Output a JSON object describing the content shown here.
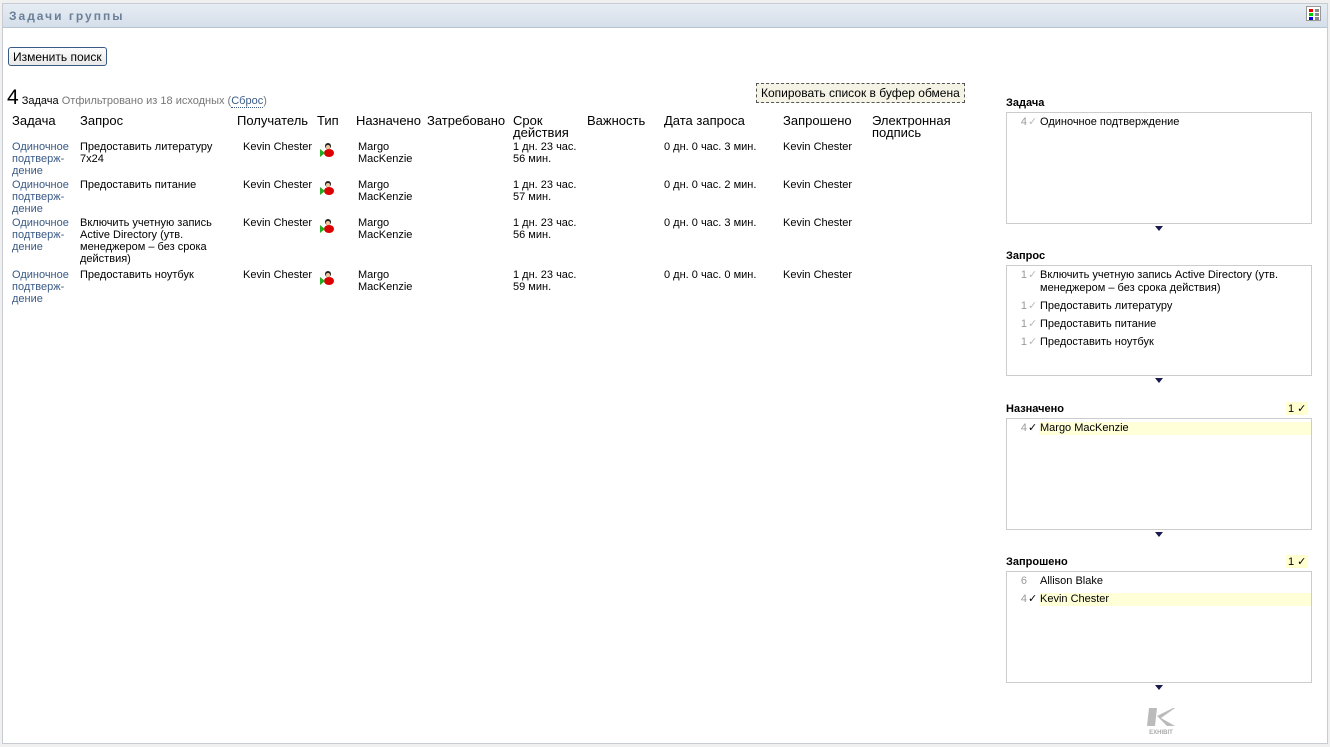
{
  "header": {
    "title": "Задачи группы",
    "icon": "view-options-icon"
  },
  "toolbar": {
    "edit_search": "Изменить поиск",
    "copy_label": "Копировать список в буфер обмена"
  },
  "summary": {
    "count": "4",
    "unit": "Задача",
    "filtered": "Отфильтровано из 18 исходных (",
    "reset": "Сброс",
    "close": ")"
  },
  "columns": [
    "Задача",
    "Запрос",
    "Получатель",
    "Тип",
    "Назначено",
    "Затребовано",
    "Срок действия",
    "Важность",
    "Дата запроса",
    "Запрошено",
    "Электронная подпись"
  ],
  "rows": [
    {
      "task": "Одиночное подтверж-дение",
      "request": "Предоставить литературу 7x24",
      "recipient": "Kevin Chester",
      "type": "approval-user-icon",
      "assigned": "Margo MacKenzie",
      "claimed": "",
      "expires": "1 дн. 23 час. 56 мин.",
      "priority": "",
      "requested_date": "0 дн. 0 час. 3 мин.",
      "requested_by": "Kevin Chester",
      "signature": ""
    },
    {
      "task": "Одиночное подтверж-дение",
      "request": "Предоставить питание",
      "recipient": "Kevin Chester",
      "type": "approval-user-icon",
      "assigned": "Margo MacKenzie",
      "claimed": "",
      "expires": "1 дн. 23 час. 57 мин.",
      "priority": "",
      "requested_date": "0 дн. 0 час. 2 мин.",
      "requested_by": "Kevin Chester",
      "signature": ""
    },
    {
      "task": "Одиночное подтверж-дение",
      "request": "Включить учетную запись Active Directory (утв. менеджером – без срока действия)",
      "recipient": "Kevin Chester",
      "type": "approval-user-icon",
      "assigned": "Margo MacKenzie",
      "claimed": "",
      "expires": "1 дн. 23 час. 56 мин.",
      "priority": "",
      "requested_date": "0 дн. 0 час. 3 мин.",
      "requested_by": "Kevin Chester",
      "signature": ""
    },
    {
      "task": "Одиночное подтверж-дение",
      "request": "Предоставить ноутбук",
      "recipient": "Kevin Chester",
      "type": "approval-user-icon",
      "assigned": "Margo MacKenzie",
      "claimed": "",
      "expires": "1 дн. 23 час. 59 мин.",
      "priority": "",
      "requested_date": "0 дн. 0 час. 0 мин.",
      "requested_by": "Kevin Chester",
      "signature": ""
    }
  ],
  "facets": [
    {
      "title": "Задача",
      "badge": "",
      "items": [
        {
          "count": "4",
          "label": "Одиночное подтверждение",
          "selected": false
        }
      ]
    },
    {
      "title": "Запрос",
      "badge": "",
      "items": [
        {
          "count": "1",
          "label": "Включить учетную запись Active Directory (утв. менеджером – без срока действия)",
          "selected": false
        },
        {
          "count": "1",
          "label": "Предоставить литературу",
          "selected": false
        },
        {
          "count": "1",
          "label": "Предоставить питание",
          "selected": false
        },
        {
          "count": "1",
          "label": "Предоставить ноутбук",
          "selected": false
        }
      ]
    },
    {
      "title": "Назначено",
      "badge": "1 ✓",
      "items": [
        {
          "count": "4",
          "label": "Margo MacKenzie",
          "selected": true
        }
      ]
    },
    {
      "title": "Запрошено",
      "badge": "1 ✓",
      "items": [
        {
          "count": "6",
          "label": "Allison Blake",
          "selected": false,
          "nocheck": true
        },
        {
          "count": "4",
          "label": "Kevin Chester",
          "selected": true
        }
      ]
    }
  ],
  "footer": {
    "logo": "EXHIBIT"
  }
}
